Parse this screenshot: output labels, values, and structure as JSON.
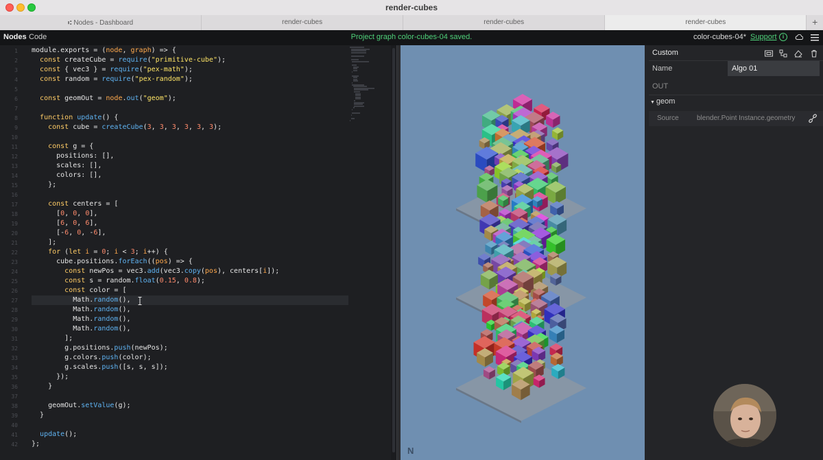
{
  "window": {
    "title": "render-cubes"
  },
  "tabs": [
    {
      "label": "Nodes - Dashboard",
      "icon": "nodes-icon"
    },
    {
      "label": "render-cubes"
    },
    {
      "label": "render-cubes"
    },
    {
      "label": "render-cubes"
    }
  ],
  "appbar": {
    "nodes_label": "Nodes",
    "code_label": "Code",
    "status": "Project graph color-cubes-04 saved.",
    "project_name": "color-cubes-04*",
    "support_label": "Support",
    "accent_color": "#4fd17a"
  },
  "editor": {
    "lines": [
      {
        "n": "1",
        "t": "module.exports = (node, graph) => {"
      },
      {
        "n": "2",
        "t": "  const createCube = require(\"primitive-cube\");"
      },
      {
        "n": "3",
        "t": "  const { vec3 } = require(\"pex-math\");"
      },
      {
        "n": "4",
        "t": "  const random = require(\"pex-random\");"
      },
      {
        "n": "5",
        "t": ""
      },
      {
        "n": "6",
        "t": "  const geomOut = node.out(\"geom\");"
      },
      {
        "n": "7",
        "t": ""
      },
      {
        "n": "8",
        "t": "  function update() {"
      },
      {
        "n": "9",
        "t": "    const cube = createCube(3, 3, 3, 3, 3, 3);"
      },
      {
        "n": "10",
        "t": ""
      },
      {
        "n": "11",
        "t": "    const g = {"
      },
      {
        "n": "12",
        "t": "      positions: [],"
      },
      {
        "n": "13",
        "t": "      scales: [],"
      },
      {
        "n": "14",
        "t": "      colors: [],"
      },
      {
        "n": "15",
        "t": "    };"
      },
      {
        "n": "16",
        "t": ""
      },
      {
        "n": "17",
        "t": "    const centers = ["
      },
      {
        "n": "18",
        "t": "      [0, 0, 0],"
      },
      {
        "n": "19",
        "t": "      [6, 0, 6],"
      },
      {
        "n": "20",
        "t": "      [-6, 0, -6],"
      },
      {
        "n": "21",
        "t": "    ];"
      },
      {
        "n": "22",
        "t": "    for (let i = 0; i < 3; i++) {"
      },
      {
        "n": "23",
        "t": "      cube.positions.forEach((pos) => {"
      },
      {
        "n": "24",
        "t": "        const newPos = vec3.add(vec3.copy(pos), centers[i]);"
      },
      {
        "n": "25",
        "t": "        const s = random.float(0.15, 0.8);"
      },
      {
        "n": "26",
        "t": "        const color = ["
      },
      {
        "n": "27",
        "t": "          Math.random(),"
      },
      {
        "n": "28",
        "t": "          Math.random(),"
      },
      {
        "n": "29",
        "t": "          Math.random(),"
      },
      {
        "n": "30",
        "t": "          Math.random(),"
      },
      {
        "n": "31",
        "t": "        ];"
      },
      {
        "n": "32",
        "t": "        g.positions.push(newPos);"
      },
      {
        "n": "33",
        "t": "        g.colors.push(color);"
      },
      {
        "n": "34",
        "t": "        g.scales.push([s, s, s]);"
      },
      {
        "n": "35",
        "t": "      });"
      },
      {
        "n": "36",
        "t": "    }"
      },
      {
        "n": "37",
        "t": ""
      },
      {
        "n": "38",
        "t": "    geomOut.setValue(g);"
      },
      {
        "n": "39",
        "t": "  }"
      },
      {
        "n": "40",
        "t": ""
      },
      {
        "n": "41",
        "t": "  update();"
      },
      {
        "n": "42",
        "t": "};"
      }
    ]
  },
  "viewport": {
    "logo": "N",
    "background_color": "#6f8fb1"
  },
  "inspector": {
    "title": "Custom",
    "name_label": "Name",
    "name_value": "Algo 01",
    "out_label": "OUT",
    "geom_label": "geom",
    "source_label": "Source",
    "source_value": "blender.Point Instance.geometry"
  }
}
